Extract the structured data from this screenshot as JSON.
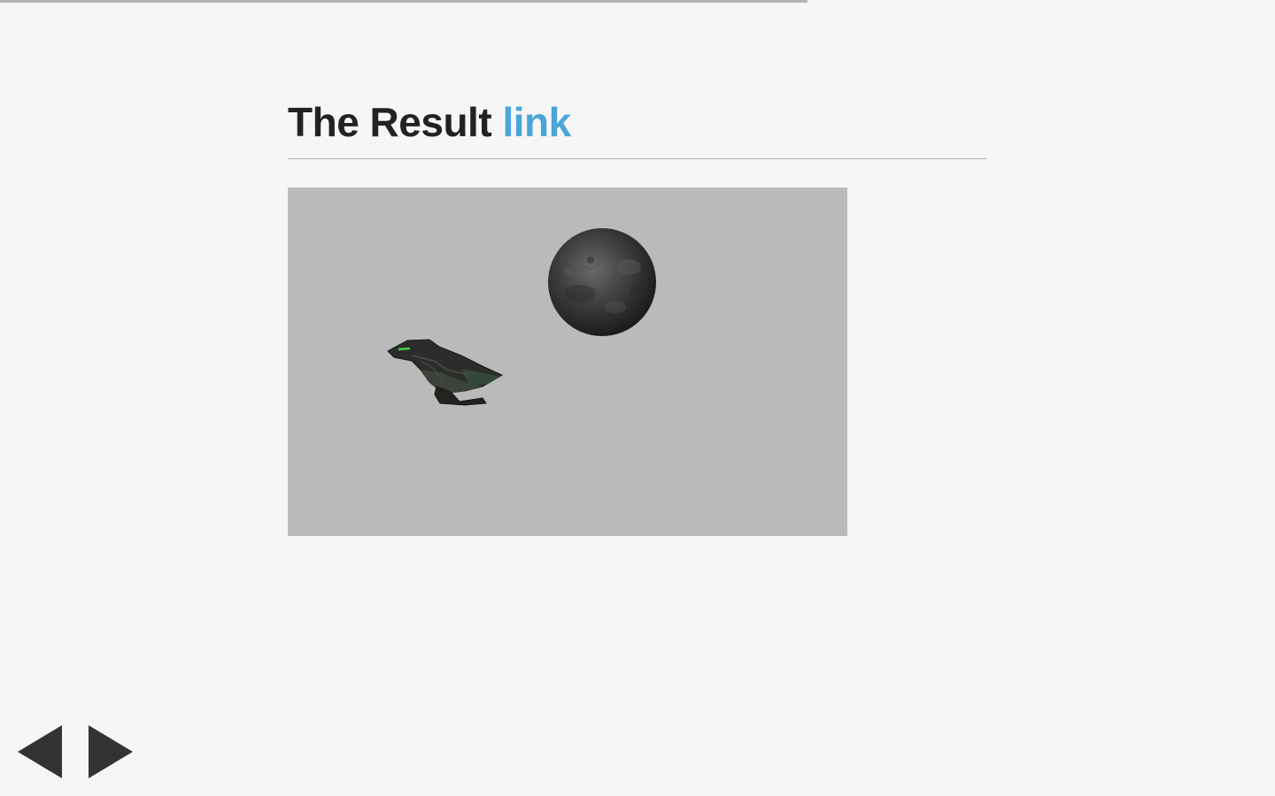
{
  "progress": {
    "fraction": 0.633
  },
  "slide": {
    "title_text": "The Result",
    "title_link": "link"
  },
  "scene": {
    "background": "#bababa",
    "objects": [
      "moon-sphere",
      "spaceship-model"
    ]
  },
  "navigation": {
    "prev_icon": "triangle-left-icon",
    "next_icon": "triangle-right-icon"
  },
  "colors": {
    "link": "#4aa5d9",
    "title": "#222222",
    "arrow": "#333333"
  }
}
